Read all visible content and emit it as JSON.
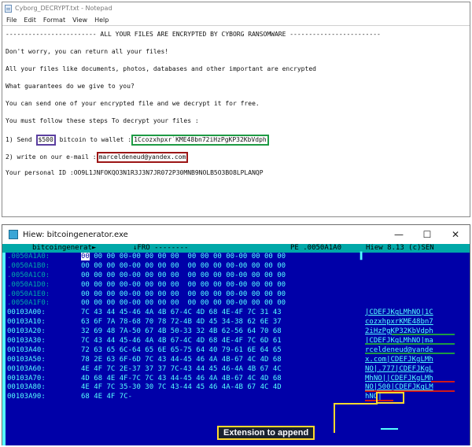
{
  "notepad": {
    "title": "Cyborg_DECRYPT.txt - Notepad",
    "menu": [
      "File",
      "Edit",
      "Format",
      "View",
      "Help"
    ],
    "lines": {
      "header": "------------------------ ALL YOUR FILES ARE ENCRYPTED BY CYBORG RANSOMWARE ------------------------",
      "l1": "Don't worry, you can return all your files!",
      "l2": "All your files like documents, photos, databases and other important are encrypted",
      "l3": "What guarantees do we give to you?",
      "l4": "You can send one of your encrypted file and we decrypt it for free.",
      "l5": "You must follow these steps To decrypt your files :",
      "send_prefix": "1) Send ",
      "amount": "$500",
      "send_mid": " bitcoin to wallet :",
      "wallet": "1Ccozxhpxr˙KME48bn72iHzPgKP32KbVdph",
      "email_prefix": "2) write on our e-mail :",
      "email": "marceldeneud@yandex.com",
      "personal_id": "Your personal ID :OO9L1JNFOKQO3N1R3J3N7JR072P30MNB9NOLB5O3BO8LPLANQP"
    }
  },
  "hiew": {
    "title": "Hiew: bitcoingenerator.exe",
    "controls": {
      "minimize": "—",
      "maximize": "☐",
      "close": "✕"
    },
    "status": {
      "filename": "bitcoingenerat►",
      "mode": "↓FRO --------",
      "format": "PE .0050A1A0",
      "version": "Hiew 8.13 (c)SEN"
    },
    "rows": [
      {
        "offset": ".0050A1A0:",
        "first": "00",
        "hex": " 00 00 00-00 00 00 00  00 00 00 00-00 00 00 00",
        "ascii": ""
      },
      {
        "offset": ".0050A1B0:",
        "first": "",
        "hex": "00 00 00 00-00 00 00 00  00 00 00 00-00 00 00 00",
        "ascii": ""
      },
      {
        "offset": ".0050A1C0:",
        "first": "",
        "hex": "00 00 00 00-00 00 00 00  00 00 00 00-00 00 00 00",
        "ascii": ""
      },
      {
        "offset": ".0050A1D0:",
        "first": "",
        "hex": "00 00 00 00-00 00 00 00  00 00 00 00-00 00 00 00",
        "ascii": ""
      },
      {
        "offset": ".0050A1E0:",
        "first": "",
        "hex": "00 00 00 00-00 00 00 00  00 00 00 00-00 00 00 00",
        "ascii": ""
      },
      {
        "offset": ".0050A1F0:",
        "first": "",
        "hex": "00 00 00 00-00 00 00 00  00 00 00 00-00 00 00 00",
        "ascii": ""
      },
      {
        "offset": "00103A00:",
        "first": "",
        "hex": "7C 43 44 45-46 4A 4B 67-4C 4D 68 4E-4F 7C 31 43",
        "ascii": "|CDEFJKgLMhNO|1C"
      },
      {
        "offset": "00103A10:",
        "first": "",
        "hex": "63 6F 7A 78-68 70 78 72-4B 4D 45 34-38 62 6E 37",
        "ascii": "cozxhpxrKME48bn7"
      },
      {
        "offset": "00103A20:",
        "first": "",
        "hex": "32 69 48 7A-50 67 4B 50-33 32 4B 62-56 64 70 68",
        "ascii": "2iHzPgKP32KbVdph"
      },
      {
        "offset": "00103A30:",
        "first": "",
        "hex": "7C 43 44 45-46 4A 4B 67-4C 4D 68 4E-4F 7C 6D 61",
        "ascii": "|CDEFJKgLMhNO|ma"
      },
      {
        "offset": "00103A40:",
        "first": "",
        "hex": "72 63 65 6C-64 65 6E 65-75 64 40 79-61 6E 64 65",
        "ascii": "rceldeneud@yande"
      },
      {
        "offset": "00103A50:",
        "first": "",
        "hex": "78 2E 63 6F-6D 7C 43 44-45 46 4A 4B-67 4C 4D 68",
        "ascii": "x.com|CDEFJKgLMh"
      },
      {
        "offset": "00103A60:",
        "first": "",
        "hex": "4E 4F 7C 2E-37 37 37 7C-43 44 45 46-4A 4B 67 4C",
        "ascii": "NO|.777|CDEFJKgL"
      },
      {
        "offset": "00103A70:",
        "first": "",
        "hex": "4D 68 4E 4F-7C 7C 43 44-45 46 4A 4B-67 4C 4D 68",
        "ascii": "MhNO||CDEFJKgLMh"
      },
      {
        "offset": "00103A80:",
        "first": "",
        "hex": "4E 4F 7C 35-30 30 7C 43-44 45 46 4A-4B 67 4C 4D",
        "ascii": "NO|500|CDEFJKgLM"
      },
      {
        "offset": "00103A90:",
        "first": "",
        "hex": "68 4E 4F 7C-",
        "ascii": "hNO|"
      }
    ],
    "annotation": "Extension to append"
  },
  "colors": {
    "hiew_background": "#0000a8",
    "hiew_text": "#55ffff",
    "hiew_statusbar": "#00a8a8",
    "box_amount": "#5b3fa0",
    "box_wallet": "#1e9a44",
    "box_email": "#9c1515",
    "annotation_border": "#ffd92e"
  }
}
